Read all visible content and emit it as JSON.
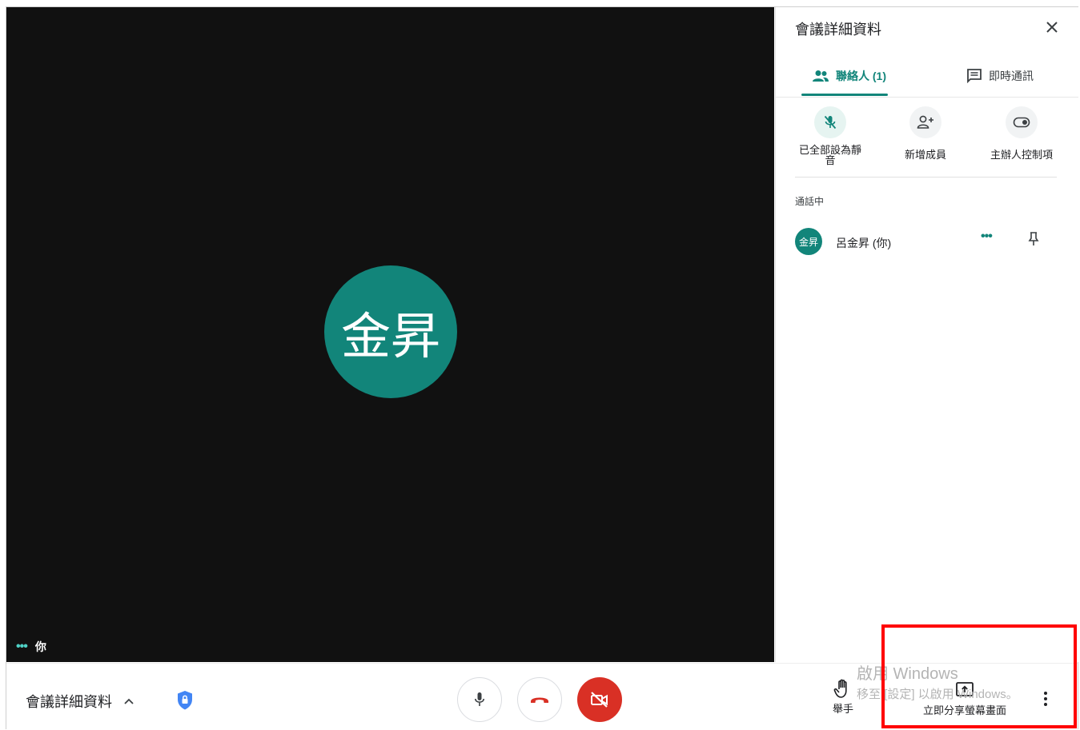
{
  "stage": {
    "avatar_text": "金昇",
    "self_label": "你",
    "self_dots": "•••"
  },
  "panel": {
    "title": "會議詳細資料",
    "tabs": {
      "people": "聯絡人 (1)",
      "chat": "即時通訊"
    },
    "actions": {
      "mute_all": "已全部設為靜音",
      "add_member": "新增成員",
      "host_controls": "主辦人控制項"
    },
    "section_label": "通話中",
    "participant": {
      "avatar_text": "金昇",
      "name": "呂金昇 (你)",
      "more": "•••"
    }
  },
  "bottom": {
    "details_label": "會議詳細資料",
    "raise_hand": "舉手",
    "present_now": "立即分享螢幕畫面"
  },
  "watermark": {
    "line1": "啟用 Windows",
    "line2": "移至 [設定] 以啟用 Windows。"
  },
  "colors": {
    "accent": "#12857a",
    "hangup_red": "#d93025",
    "stage_bg": "#111111",
    "highlight_box": "#ff0000"
  }
}
